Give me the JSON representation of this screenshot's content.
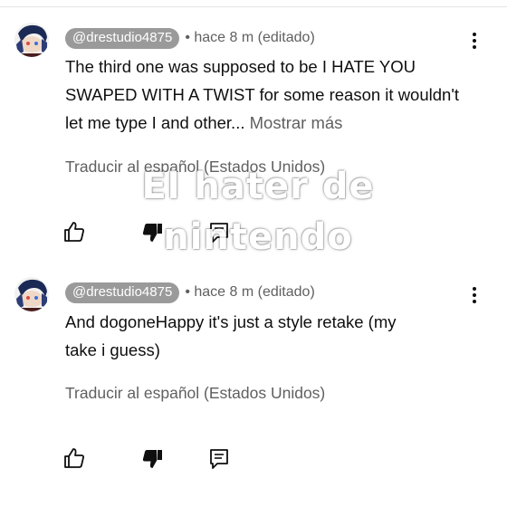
{
  "comments": [
    {
      "handle": "@drestudio4875",
      "time": "• hace 8 m (editado)",
      "body_main": "The third one was supposed to be I HATE YOU SWAPED WITH A TWIST for some reason it wouldn't let me type I and other...",
      "more_label": "Mostrar más",
      "translate": "Traducir al español (Estados Unidos)",
      "icons": {
        "like": "thumbs-up-icon",
        "dislike": "thumbs-down-icon",
        "reply": "reply-icon",
        "menu": "more-vertical-icon"
      }
    },
    {
      "handle": "@drestudio4875",
      "time": "• hace 8 m (editado)",
      "body_main": "And dogoneHappy it's just a style retake (my take i guess)",
      "translate": "Traducir al español (Estados Unidos)",
      "icons": {
        "like": "thumbs-up-icon",
        "dislike": "thumbs-down-icon",
        "reply": "reply-icon",
        "menu": "more-vertical-icon"
      }
    }
  ],
  "watermark": {
    "line1": "El hater de",
    "line2": "nintendo"
  },
  "colors": {
    "handle_bg": "#9a9a9a",
    "secondary_text": "#606060",
    "primary_text": "#0f0f0f"
  }
}
